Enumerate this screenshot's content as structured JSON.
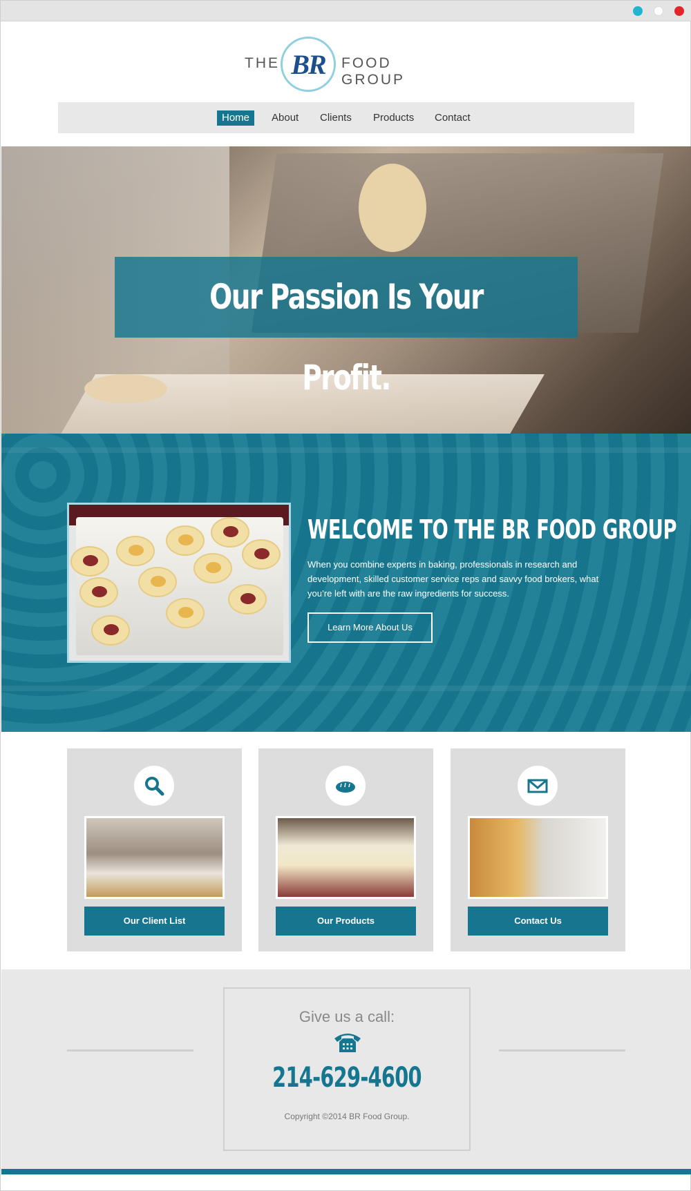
{
  "colors": {
    "accent": "#167690",
    "nav_bg": "#e8e8e8",
    "card_bg": "#dddddd"
  },
  "window": {
    "controls": [
      "cyan-dot",
      "white-dot",
      "red-dot"
    ]
  },
  "logo": {
    "left_text": "THE",
    "monogram": "BR",
    "right_text": "FOOD GROUP"
  },
  "nav": {
    "items": [
      "Home",
      "About",
      "Clients",
      "Products",
      "Contact"
    ],
    "active": "Home"
  },
  "hero": {
    "headline": "Our Passion Is Your Profit."
  },
  "welcome": {
    "heading": "WELCOME TO THE BR FOOD GROUP",
    "body": "When you combine experts in baking, professionals in research and development, skilled customer service reps and savvy food brokers, what you’re left with are the raw ingredients for success.",
    "button": "Learn More About Us"
  },
  "cards": [
    {
      "icon": "search-icon",
      "button": "Our Client List"
    },
    {
      "icon": "bread-icon",
      "button": "Our Products"
    },
    {
      "icon": "envelope-icon",
      "button": "Contact Us"
    }
  ],
  "footer": {
    "call_label": "Give us a call:",
    "phone": "214-629-4600",
    "copyright": "Copyright ©2014 BR Food Group."
  }
}
